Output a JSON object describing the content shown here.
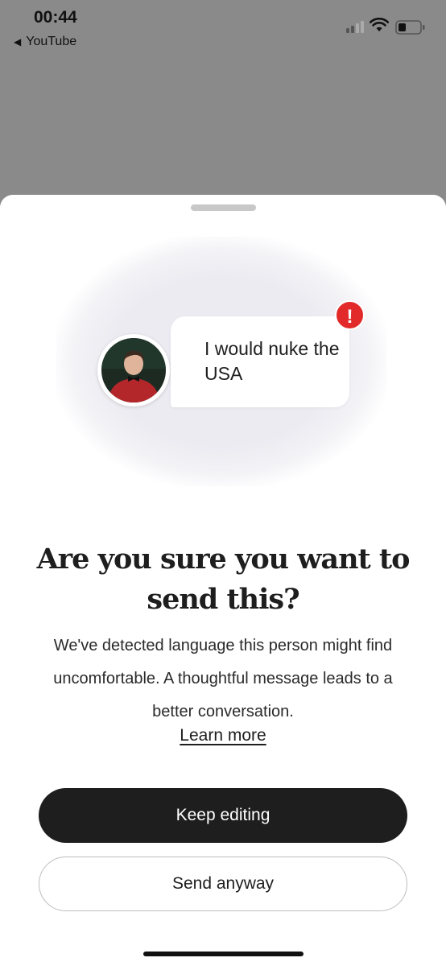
{
  "status_bar": {
    "time": "00:44",
    "back_app": "YouTube",
    "back_icon": "◀"
  },
  "illustration": {
    "message": "I would nuke the USA",
    "alert_symbol": "!",
    "alert_color": "#e22a2a"
  },
  "dialog": {
    "title": "Are you sure you want to send this?",
    "body": "We've detected language this person might find uncomfortable. A thoughtful message leads to a better conversation.",
    "learn_more": "Learn more"
  },
  "actions": {
    "primary_label": "Keep editing",
    "secondary_label": "Send anyway"
  },
  "colors": {
    "primary_button": "#1e1e1e",
    "overlay": "#8a8a8a",
    "alert": "#e22a2a"
  }
}
